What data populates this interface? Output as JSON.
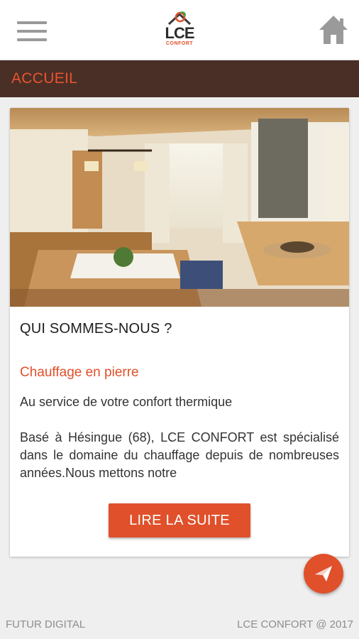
{
  "header": {
    "menu_icon": "hamburger-menu-icon",
    "logo": {
      "text": "LCE",
      "subtext": "CONFORT"
    },
    "home_icon": "home-icon"
  },
  "section": {
    "title": "ACCUEIL"
  },
  "card": {
    "image": "interior-room-photo",
    "heading": "QUI SOMMES-NOUS ?",
    "subheading": "Chauffage en pierre",
    "tagline": "Au service de votre confort thermique",
    "body": "Basé à Hésingue (68), LCE CONFORT est spécialisé dans le domaine du chauffage depuis de nombreuses années.Nous mettons notre",
    "button_label": "LIRE LA SUITE"
  },
  "fab": {
    "icon": "send-icon"
  },
  "footer": {
    "left": "FUTUR DIGITAL",
    "right": "LCE CONFORT @ 2017"
  },
  "colors": {
    "accent": "#e0502b",
    "section_bar": "#4a2f27",
    "background": "#efefef"
  }
}
